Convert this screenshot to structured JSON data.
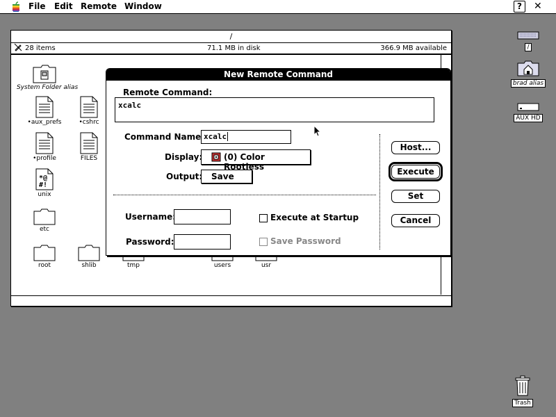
{
  "menubar": {
    "items": [
      "File",
      "Edit",
      "Remote",
      "Window"
    ],
    "help_icon": "?",
    "app_icon": "✕"
  },
  "finder": {
    "title": "/",
    "item_count": "28 items",
    "disk_usage": "71.1 MB in disk",
    "available": "366.9 MB available",
    "icons": [
      {
        "label": "System Folder alias",
        "icon": "system-folder-icon"
      },
      {
        "label": "•aux_prefs",
        "icon": "document-icon"
      },
      {
        "label": "•cshrc",
        "icon": "document-icon"
      },
      {
        "label": "•profile",
        "icon": "document-icon"
      },
      {
        "label": "FILES",
        "icon": "document-icon"
      },
      {
        "label": "unix",
        "icon": "unix-script-icon"
      },
      {
        "label": "etc",
        "icon": "folder-icon"
      },
      {
        "label": "root",
        "icon": "folder-icon"
      },
      {
        "label": "shlib",
        "icon": "folder-icon"
      },
      {
        "label": "tmp",
        "icon": "folder-icon"
      },
      {
        "label": "users",
        "icon": "folder-icon"
      },
      {
        "label": "usr",
        "icon": "folder-icon"
      }
    ]
  },
  "desktop": {
    "icons": [
      {
        "label": "/",
        "icon": "disk-icon"
      },
      {
        "label": "brad alias",
        "icon": "home-folder-icon"
      },
      {
        "label": "AUX HD",
        "icon": "hard-drive-icon"
      },
      {
        "label": "Trash",
        "icon": "trash-icon"
      }
    ]
  },
  "dialog": {
    "title": "New Remote Command",
    "remote_command_label": "Remote Command:",
    "remote_command_value": "xcalc",
    "command_name_label": "Command Name:",
    "command_name_value": "xcalc",
    "display_label": "Display:",
    "display_value": "(0) Color Rootless",
    "output_label": "Output:",
    "output_value": "Save",
    "username_label": "Username:",
    "username_value": "",
    "password_label": "Password:",
    "password_value": "",
    "execute_at_startup_label": "Execute at Startup",
    "save_password_label": "Save Password",
    "buttons": {
      "host": "Host...",
      "execute": "Execute",
      "set": "Set",
      "cancel": "Cancel"
    }
  }
}
